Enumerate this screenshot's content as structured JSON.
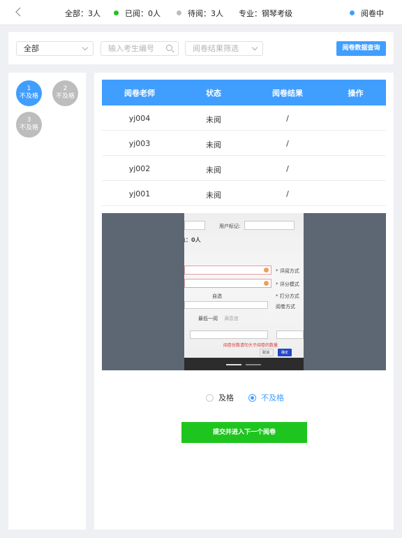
{
  "topbar": {
    "back_icon": "chevron-left-icon",
    "total": "全部：3人",
    "read": "已阅：0人",
    "pending": "待阅：3人",
    "major": "专业：钢琴考级",
    "status": "阅卷中",
    "colors": {
      "read_dot": "#1fc51f",
      "pending_dot": "#bbbbbb",
      "status_dot": "#409eff"
    }
  },
  "filters": {
    "scope_value": "全部",
    "student_placeholder": "输入考生编号",
    "result_placeholder": "阅卷结果筛选",
    "query_button": "阅卷数据查询"
  },
  "candidates": [
    {
      "number": "1",
      "result": "不及格",
      "active": true
    },
    {
      "number": "2",
      "result": "不及格",
      "active": false
    },
    {
      "number": "3",
      "result": "不及格",
      "active": false
    }
  ],
  "table": {
    "headers": [
      "阅卷老师",
      "状态",
      "阅卷结果",
      "操作"
    ],
    "rows": [
      {
        "teacher": "yj004",
        "status": "未阅",
        "result": "/",
        "action": ""
      },
      {
        "teacher": "yj003",
        "status": "未阅",
        "result": "/",
        "action": ""
      },
      {
        "teacher": "yj002",
        "status": "未阅",
        "result": "/",
        "action": ""
      },
      {
        "teacher": "yj001",
        "status": "未阅",
        "result": "/",
        "action": ""
      }
    ]
  },
  "photo": {
    "label1": "用户标记:",
    "count": "总：0人",
    "field1": "* 评阅方式",
    "field2": "* 评分模式",
    "field3": "* 打分方式",
    "field4": "阅卷方式",
    "opt1": "自选",
    "opt2": "最低一阅",
    "opt3": "满意度",
    "warning": "阅卷份数请勿大于阅卷的数量",
    "cancel": "取消",
    "confirm": "确定"
  },
  "grading": {
    "options": [
      "及格",
      "不及格"
    ],
    "selected": "不及格"
  },
  "submit_button": "提交并进入下一个阅卷",
  "accent_color": "#409eff",
  "submit_color": "#1fc51f"
}
